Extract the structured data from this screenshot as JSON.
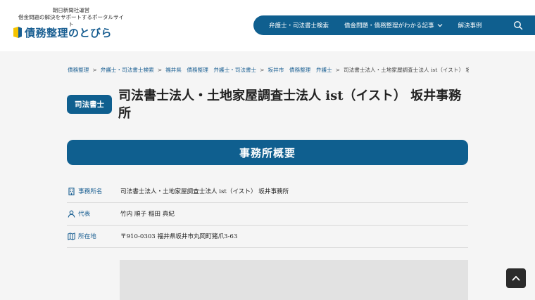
{
  "header": {
    "tagline_line1": "朝日新聞社運営",
    "tagline_line2": "借金問題の解決をサポートするポータルサイト",
    "logo_text": "債務整理のとびら",
    "nav": [
      {
        "label": "弁護士・司法書士検索"
      },
      {
        "label": "借金問題・債務整理がわかる記事"
      },
      {
        "label": "解決事例"
      }
    ]
  },
  "breadcrumb": [
    "債務整理",
    "弁護士・司法書士検索",
    "福井県　債務整理　弁護士・司法書士",
    "坂井市　債務整理　弁護士",
    "司法書士法人・土地家屋調査士法人 ist（イスト） 坂井事務所"
  ],
  "category_badge": "司法書士",
  "page_title": "司法書士法人・土地家屋調査士法人 ist（イスト） 坂井事務所",
  "section_title": "事務所概要",
  "office_info": [
    {
      "label": "事務所名",
      "icon": "building-icon",
      "value": "司法書士法人・土地家屋調査士法人 ist（イスト） 坂井事務所"
    },
    {
      "label": "代表",
      "icon": "person-icon",
      "value": "竹内 順子 稲田 真紀"
    },
    {
      "label": "所在地",
      "icon": "map-icon",
      "value": "〒910-0303 福井県坂井市丸岡町猪爪3-63"
    }
  ],
  "colors": {
    "primary": "#0f5f8f",
    "link": "#1a5f92",
    "background": "#f5f5f5",
    "logo_accent": "#f5c400"
  }
}
